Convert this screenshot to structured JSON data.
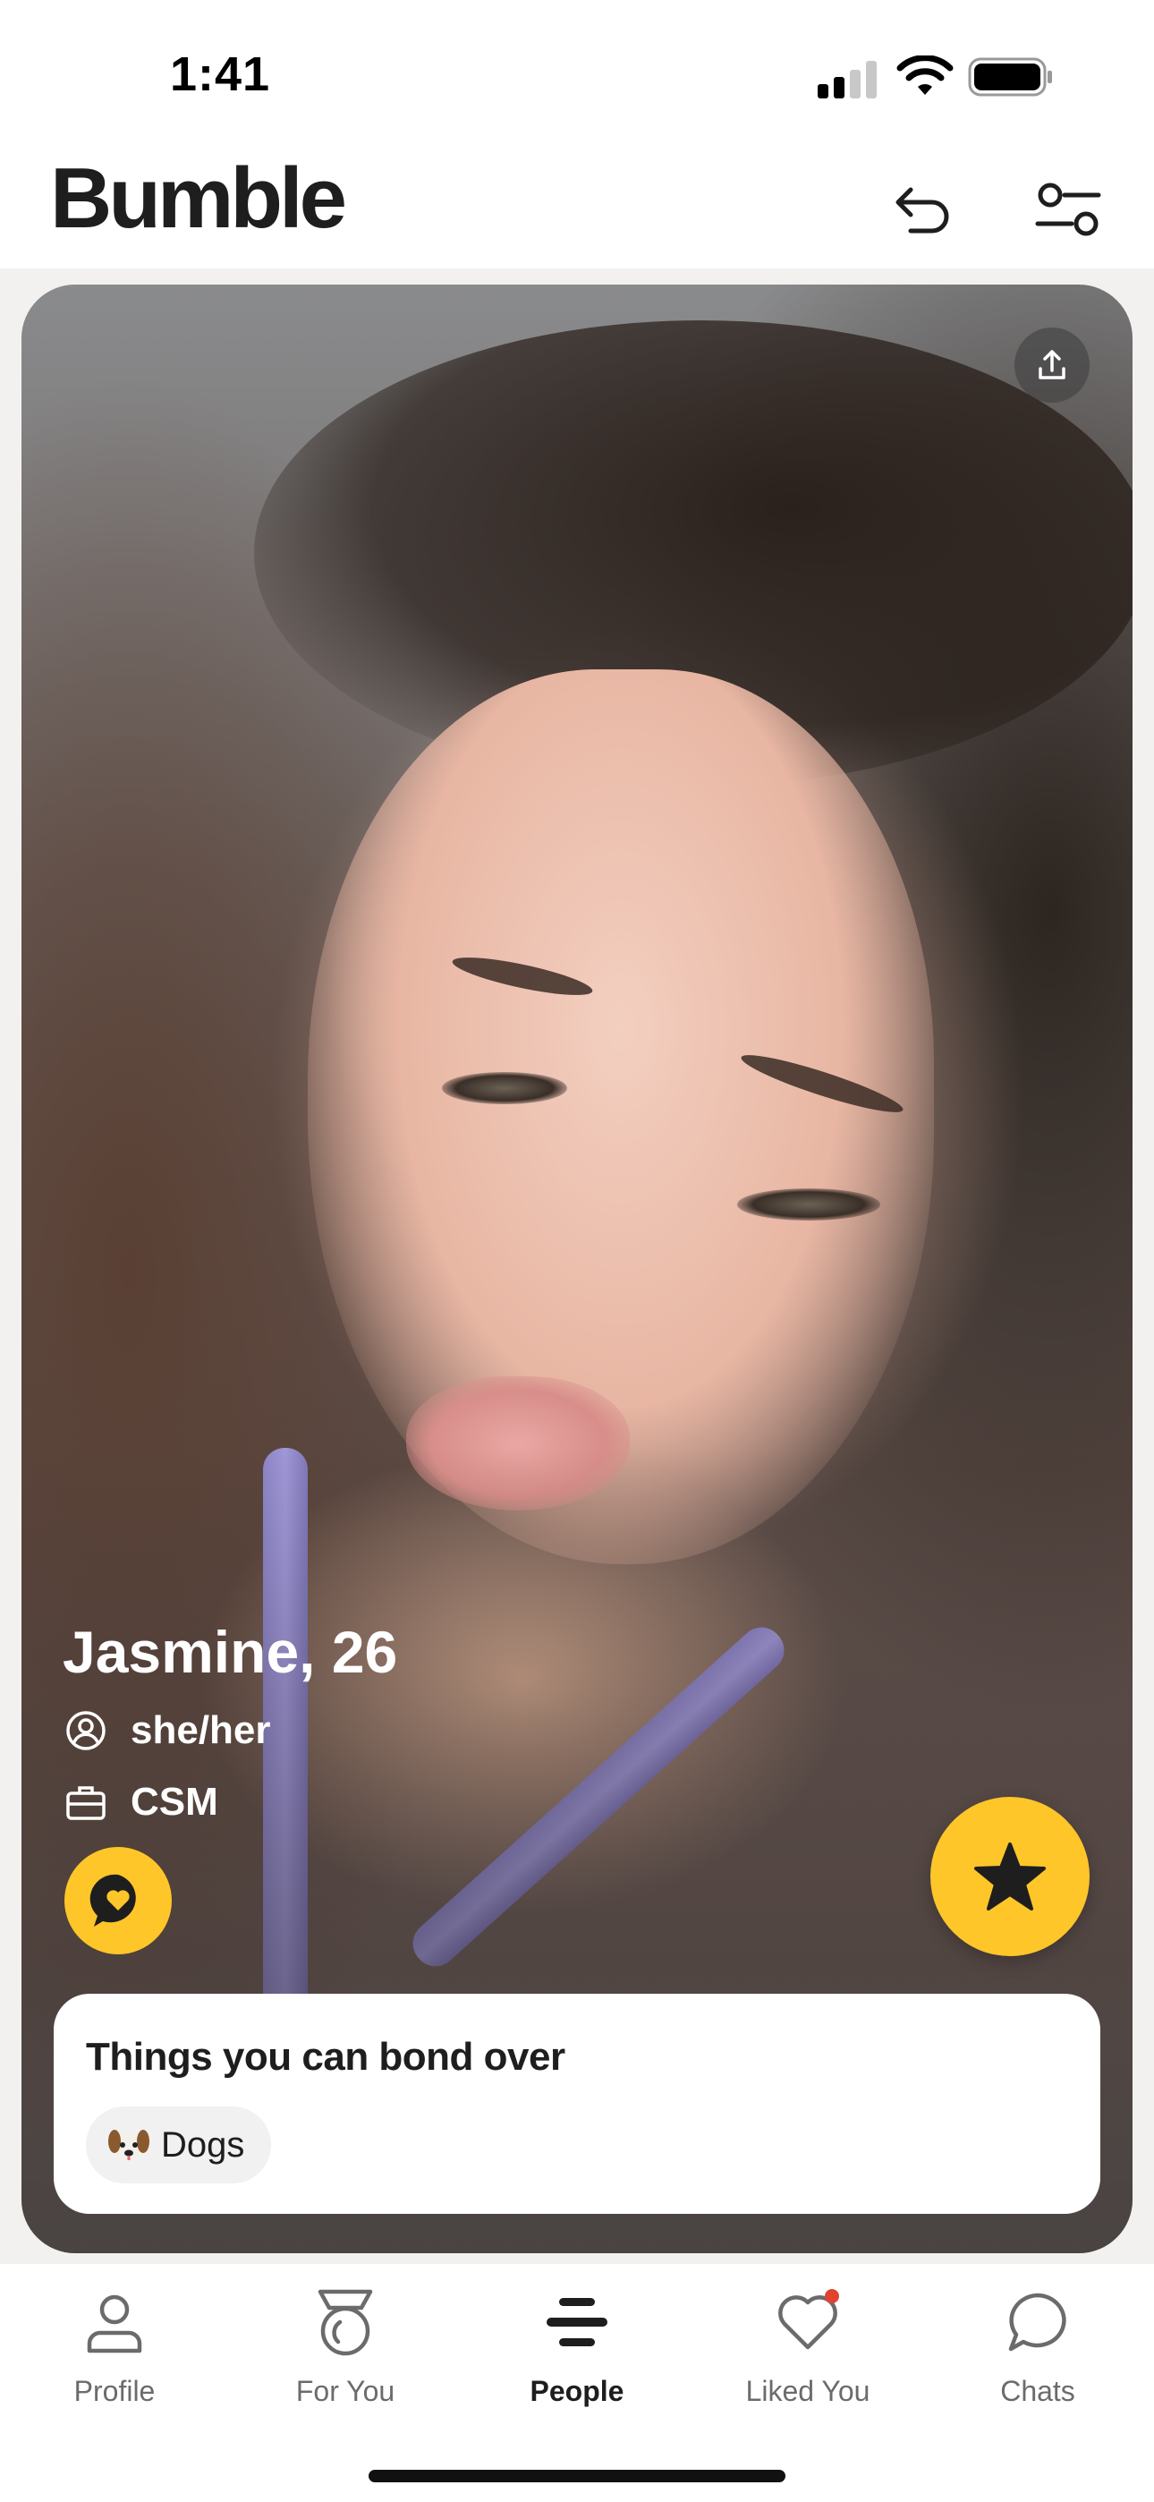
{
  "status_bar": {
    "time": "1:41"
  },
  "header": {
    "brand": "Bumble"
  },
  "profile": {
    "name_age": "Jasmine, 26",
    "pronouns": "she/her",
    "job": "CSM"
  },
  "bond": {
    "title": "Things you can bond over",
    "chips": [
      {
        "emoji": "dog-face",
        "label": "Dogs"
      }
    ]
  },
  "tabs": [
    {
      "label": "Profile",
      "icon": "person-icon",
      "active": false
    },
    {
      "label": "For You",
      "icon": "medal-icon",
      "active": false
    },
    {
      "label": "People",
      "icon": "stack-icon",
      "active": true
    },
    {
      "label": "Liked You",
      "icon": "heart-icon",
      "active": false,
      "badge": true
    },
    {
      "label": "Chats",
      "icon": "chat-bubble-icon",
      "active": false
    }
  ],
  "colors": {
    "accent": "#ffc629",
    "badge": "#e0432f",
    "text": "#1e1e1e"
  }
}
